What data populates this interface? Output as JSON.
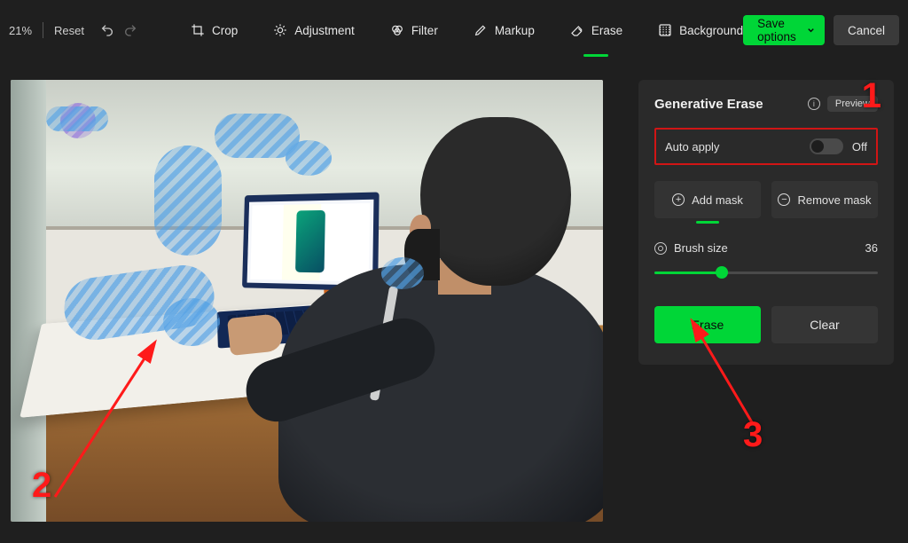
{
  "toolbar": {
    "zoom": "21%",
    "reset": "Reset",
    "tools": {
      "crop": "Crop",
      "adjustment": "Adjustment",
      "filter": "Filter",
      "markup": "Markup",
      "erase": "Erase",
      "background": "Background"
    },
    "save_label": "Save options",
    "cancel_label": "Cancel"
  },
  "panel": {
    "title": "Generative Erase",
    "preview_badge": "Preview",
    "auto_apply_label": "Auto apply",
    "auto_apply_state": "Off",
    "add_mask": "Add mask",
    "remove_mask": "Remove mask",
    "brush_label": "Brush size",
    "brush_value": "36",
    "brush_percent": 30,
    "erase": "Erase",
    "clear": "Clear"
  },
  "annotations": {
    "n1": "1",
    "n2": "2",
    "n3": "3"
  }
}
